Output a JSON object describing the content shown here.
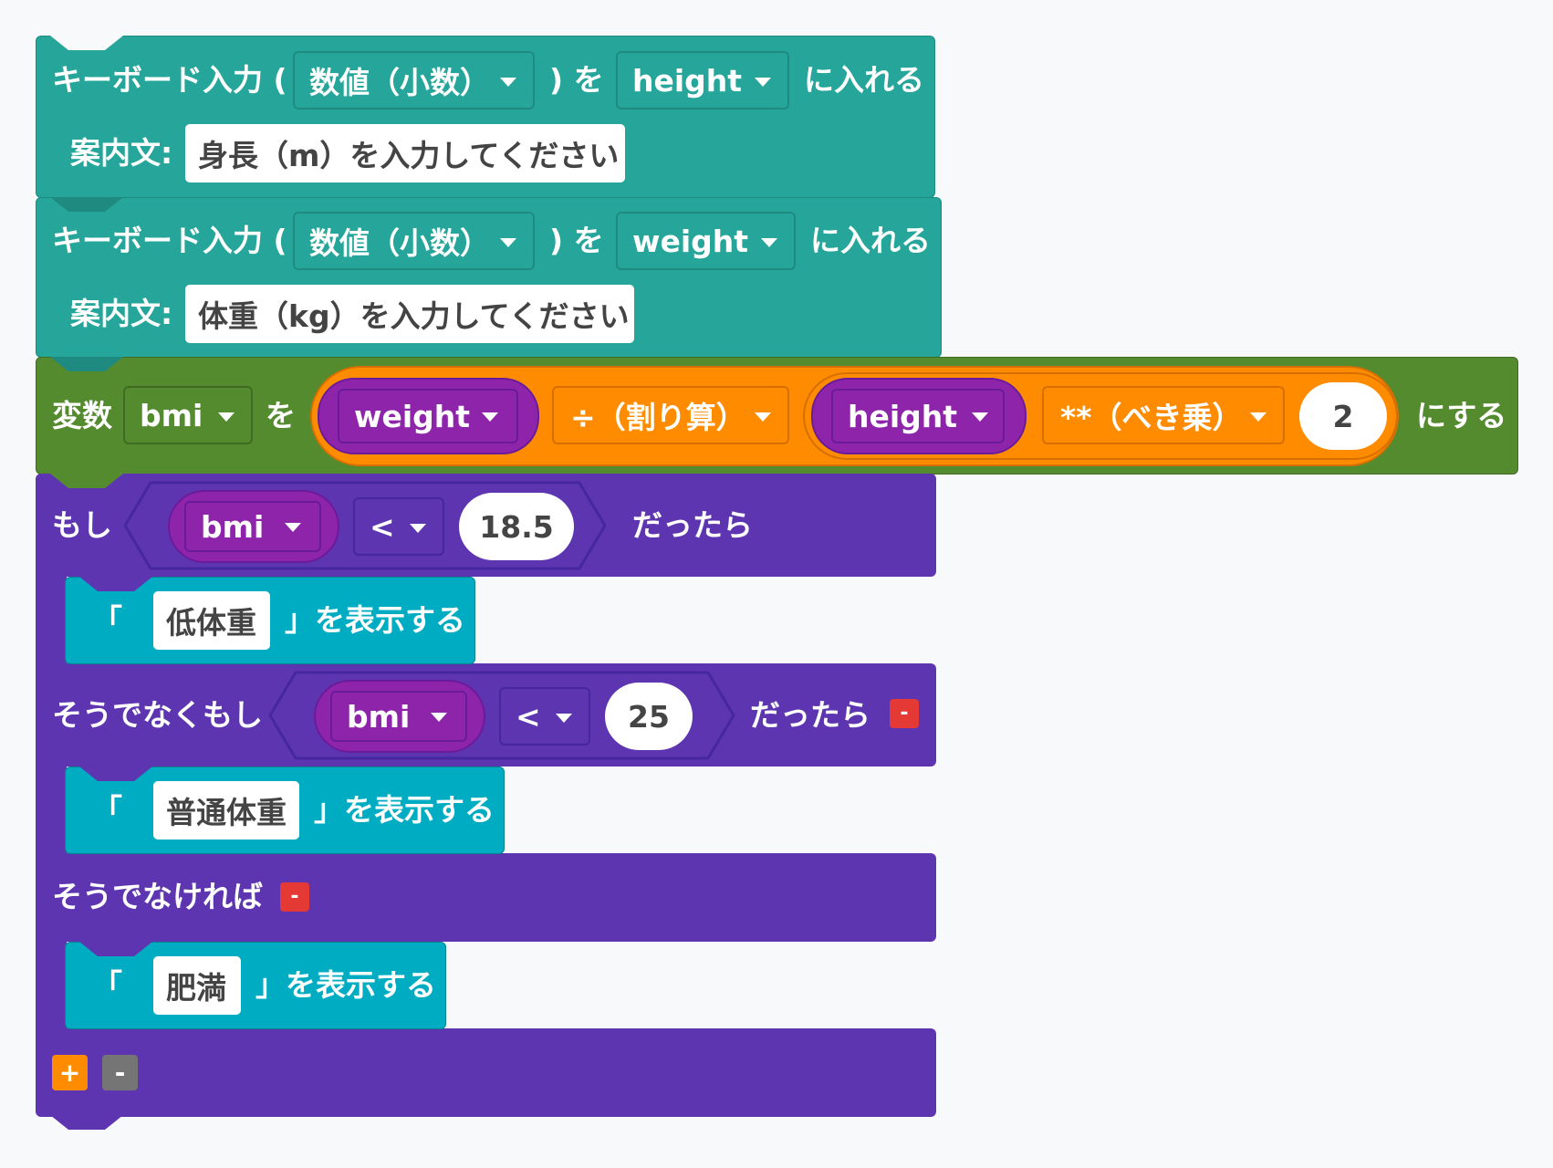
{
  "colors": {
    "teal": "#26a69a",
    "cyan": "#00acc1",
    "green": "#558b2f",
    "purple": "#5e35b1",
    "magenta": "#8e24aa",
    "orange": "#ff8c00",
    "red": "#e53935",
    "gray": "#757575",
    "background": "#f8f9fa"
  },
  "input1": {
    "label": "キーボード入力 (",
    "type_value": "数値（小数）",
    "mid": ") を",
    "var": "height",
    "end": "に入れる",
    "prompt_label": "案内文:",
    "prompt_text": "身長（m）を入力してください"
  },
  "input2": {
    "label": "キーボード入力 (",
    "type_value": "数値（小数）",
    "mid": ") を",
    "var": "weight",
    "end": "に入れる",
    "prompt_label": "案内文:",
    "prompt_text": "体重（kg）を入力してください"
  },
  "setvar": {
    "label": "変数",
    "var": "bmi",
    "mid": "を",
    "operand1": "weight",
    "op1": "÷（割り算）",
    "operand2": "height",
    "op2": "**（べき乗）",
    "exponent": "2",
    "end": "にする"
  },
  "ifblock": {
    "if_label": "もし",
    "if_var": "bmi",
    "if_op": "<",
    "if_value": "18.5",
    "if_then": "だったら",
    "print1_open": "「",
    "print1_text": "低体重",
    "print1_close": "」を表示する",
    "elif_label": "そうでなくもし",
    "elif_var": "bmi",
    "elif_op": "<",
    "elif_value": "25",
    "elif_then": "だったら",
    "elif_remove": "-",
    "print2_open": "「",
    "print2_text": "普通体重",
    "print2_close": "」を表示する",
    "else_label": "そうでなければ",
    "else_remove": "-",
    "print3_open": "「",
    "print3_text": "肥満",
    "print3_close": "」を表示する",
    "add_button": "+",
    "remove_button": "-"
  }
}
